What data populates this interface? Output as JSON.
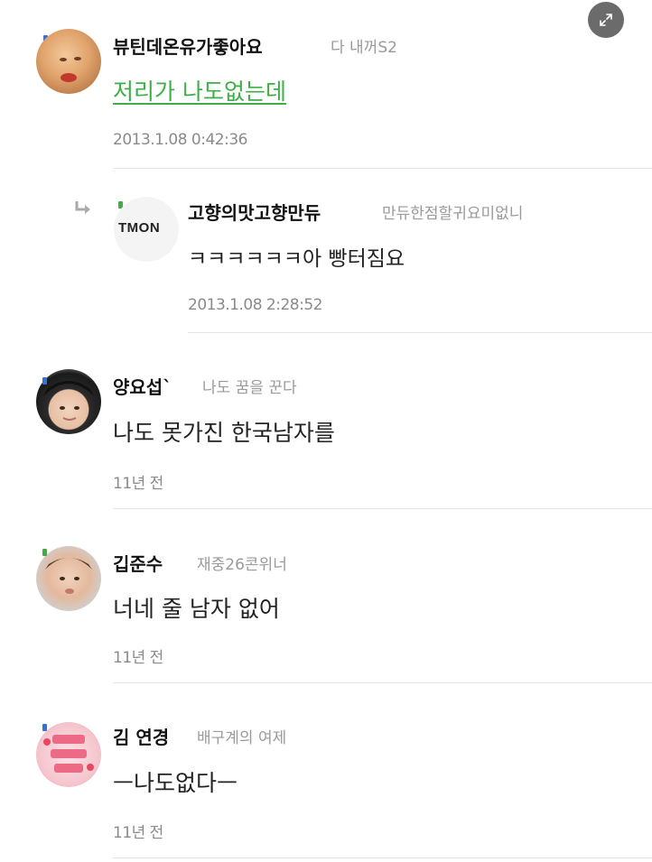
{
  "comments": [
    {
      "name": "뷰틴데온유가좋아요",
      "nickname": "다 내꺼S2",
      "body": "저리가 나도없는데",
      "time": "2013.1.08 0:42:36",
      "level_color": "#3a6fd8"
    },
    {
      "name": "고향의맛고향만듀",
      "nickname": "만듀한점할귀요미없니",
      "body": "ㅋㅋㅋㅋㅋㅋ아 빵터짐요",
      "time": "2013.1.08 2:28:52",
      "avatar_text": "TMON",
      "level_color": "#3fae49"
    },
    {
      "name": "양요섭ˋ",
      "nickname": "나도 꿈을 꾼다",
      "body": "나도 못가진 한국남자를",
      "time": "11년 전",
      "level_color": "#3a6fd8"
    },
    {
      "name": "깁준수",
      "nickname": "재중26콘위너",
      "body": "너네 줄 남자 없어",
      "time": "11년 전",
      "level_color": "#3fae49"
    },
    {
      "name": "김 연경",
      "nickname": "배구계의 여제",
      "body": "ㅡ나도없다ㅡ",
      "time": "11년 전",
      "level_color": "#3a6fd8"
    }
  ],
  "colors": {
    "link": "#3fae49",
    "meta": "#9a9a9a",
    "separator": "#e4e4e4"
  }
}
